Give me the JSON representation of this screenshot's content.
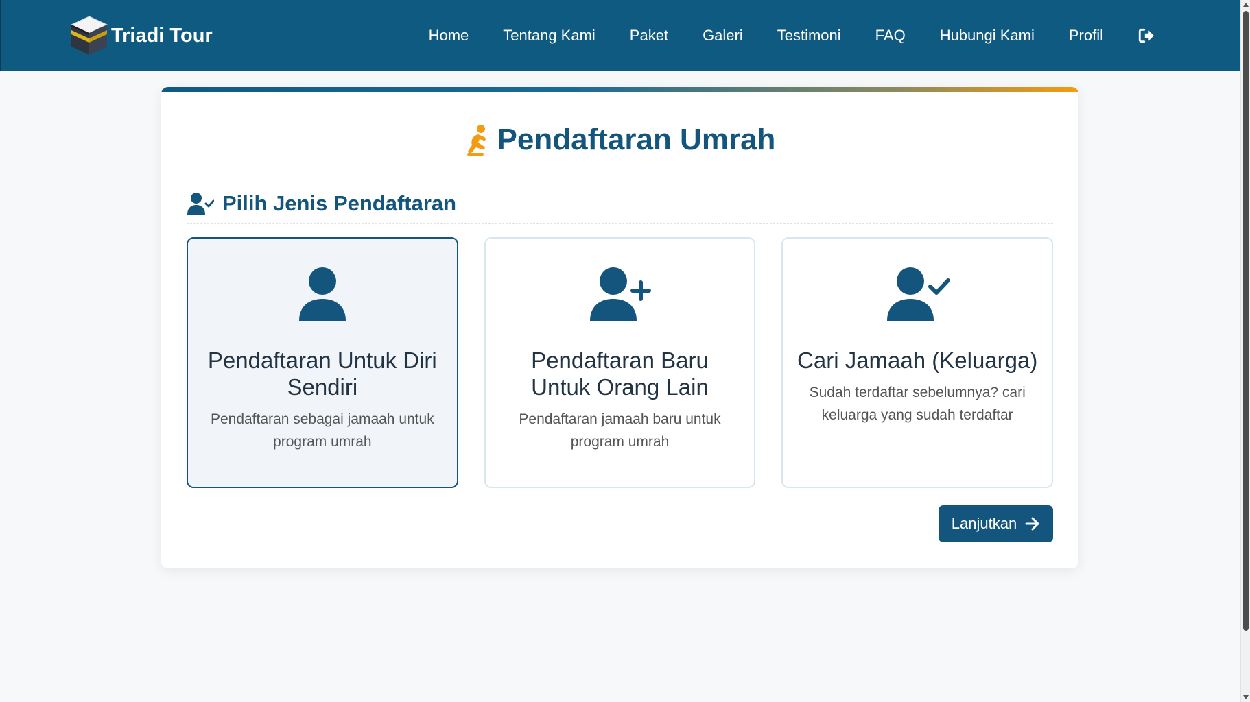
{
  "navbar": {
    "brand": "Triadi Tour",
    "links": [
      "Home",
      "Tentang Kami",
      "Paket",
      "Galeri",
      "Testimoni",
      "FAQ",
      "Hubungi Kami",
      "Profil"
    ],
    "logout_icon": "sign-out-icon"
  },
  "page": {
    "title": "Pendaftaran Umrah",
    "title_icon": "praying-person-icon"
  },
  "section": {
    "title": "Pilih Jenis Pendaftaran",
    "icon": "user-check-icon"
  },
  "options": [
    {
      "title": "Pendaftaran Untuk Diri Sendiri",
      "description": "Pendaftaran sebagai jamaah untuk program umrah",
      "icon": "user-icon",
      "selected": true
    },
    {
      "title": "Pendaftaran Baru Untuk Orang Lain",
      "description": "Pendaftaran jamaah baru untuk program umrah",
      "icon": "user-plus-icon",
      "selected": false
    },
    {
      "title": "Cari Jamaah (Keluarga)",
      "description": "Sudah terdaftar sebelumnya? cari keluarga yang sudah terdaftar",
      "icon": "user-check-icon",
      "selected": false
    }
  ],
  "actions": {
    "next_label": "Lanjutkan"
  },
  "colors": {
    "primary": "#13557d",
    "navbar": "#0e5a80",
    "accent": "#f39c12"
  }
}
